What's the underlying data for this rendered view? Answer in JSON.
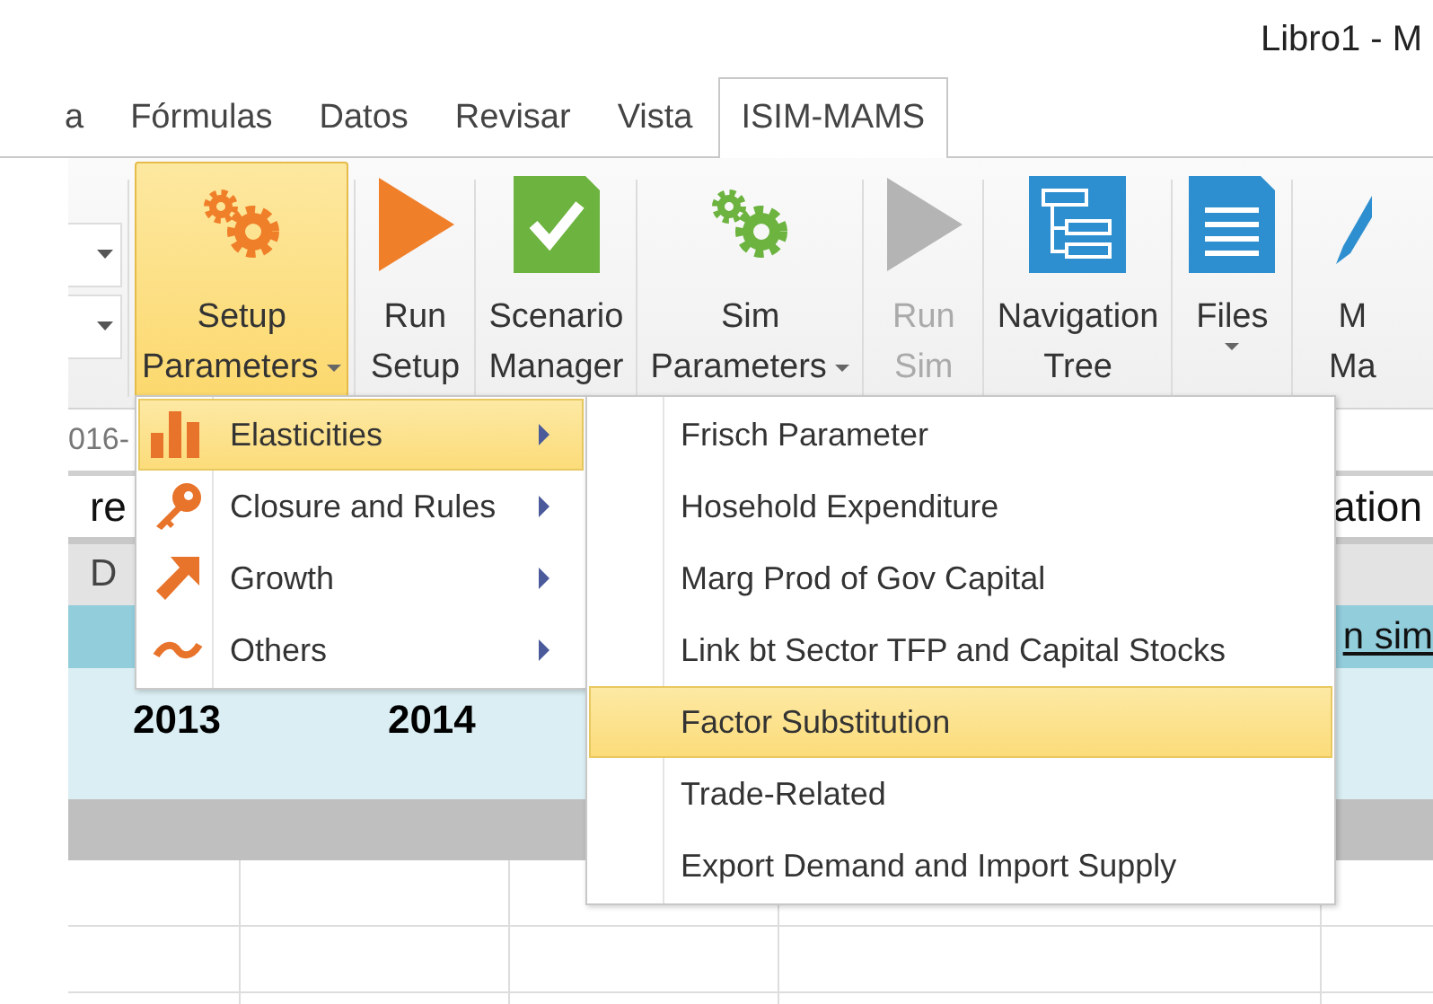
{
  "window": {
    "title": "Libro1 - M"
  },
  "tabs": [
    {
      "label": "a",
      "selected": false
    },
    {
      "label": "Fórmulas",
      "selected": false
    },
    {
      "label": "Datos",
      "selected": false
    },
    {
      "label": "Revisar",
      "selected": false
    },
    {
      "label": "Vista",
      "selected": false
    },
    {
      "label": "ISIM-MAMS",
      "selected": true
    }
  ],
  "ribbon_buttons": [
    {
      "lines": [
        "Setup",
        "Parameters"
      ],
      "kind": "gears",
      "color": "#f07f2a",
      "dropdown": true,
      "selected": true,
      "disabled": false
    },
    {
      "lines": [
        "Run",
        "Setup"
      ],
      "kind": "play",
      "color": "#f07f2a",
      "dropdown": false,
      "selected": false,
      "disabled": false
    },
    {
      "lines": [
        "Scenario",
        "Manager"
      ],
      "kind": "check-document",
      "color": "#6cb33f",
      "dropdown": false,
      "selected": false,
      "disabled": false
    },
    {
      "lines": [
        "Sim",
        "Parameters"
      ],
      "kind": "gears",
      "color": "#6cb33f",
      "dropdown": true,
      "selected": false,
      "disabled": false
    },
    {
      "lines": [
        "Run",
        "Sim"
      ],
      "kind": "play",
      "color": "#b4b4b4",
      "dropdown": false,
      "selected": false,
      "disabled": true
    },
    {
      "lines": [
        "Navigation",
        "Tree"
      ],
      "kind": "tree",
      "color": "#2e8fd0",
      "dropdown": false,
      "selected": false,
      "disabled": false
    },
    {
      "lines": [
        "Files"
      ],
      "kind": "document",
      "color": "#2e8fd0",
      "dropdown": true,
      "selected": false,
      "disabled": false
    },
    {
      "lines": [
        "M",
        "Ma"
      ],
      "kind": "pen",
      "color": "#2e8fd0",
      "dropdown": false,
      "selected": false,
      "disabled": false
    }
  ],
  "formula_bar": {
    "name_box": "016-"
  },
  "sheet": {
    "left_title": "re",
    "right_title": "ation",
    "column_header": "D",
    "link": "n sim",
    "years": [
      "2013",
      "2014"
    ]
  },
  "menu": {
    "items": [
      {
        "label": "Elasticities",
        "kind": "bars",
        "submenu": true,
        "selected": true
      },
      {
        "label": "Closure and Rules",
        "kind": "key",
        "submenu": true,
        "selected": false
      },
      {
        "label": "Growth",
        "kind": "arrow",
        "submenu": true,
        "selected": false
      },
      {
        "label": "Others",
        "kind": "tilde",
        "submenu": true,
        "selected": false
      }
    ]
  },
  "submenu": {
    "items": [
      {
        "label": "Frisch Parameter",
        "selected": false
      },
      {
        "label": "Hosehold Expenditure",
        "selected": false
      },
      {
        "label": "Marg Prod of Gov Capital",
        "selected": false
      },
      {
        "label": "Link bt Sector TFP and Capital Stocks",
        "selected": false
      },
      {
        "label": "Factor Substitution",
        "selected": true
      },
      {
        "label": "Trade-Related",
        "selected": false
      },
      {
        "label": "Export Demand and Import Supply",
        "selected": false
      }
    ]
  }
}
